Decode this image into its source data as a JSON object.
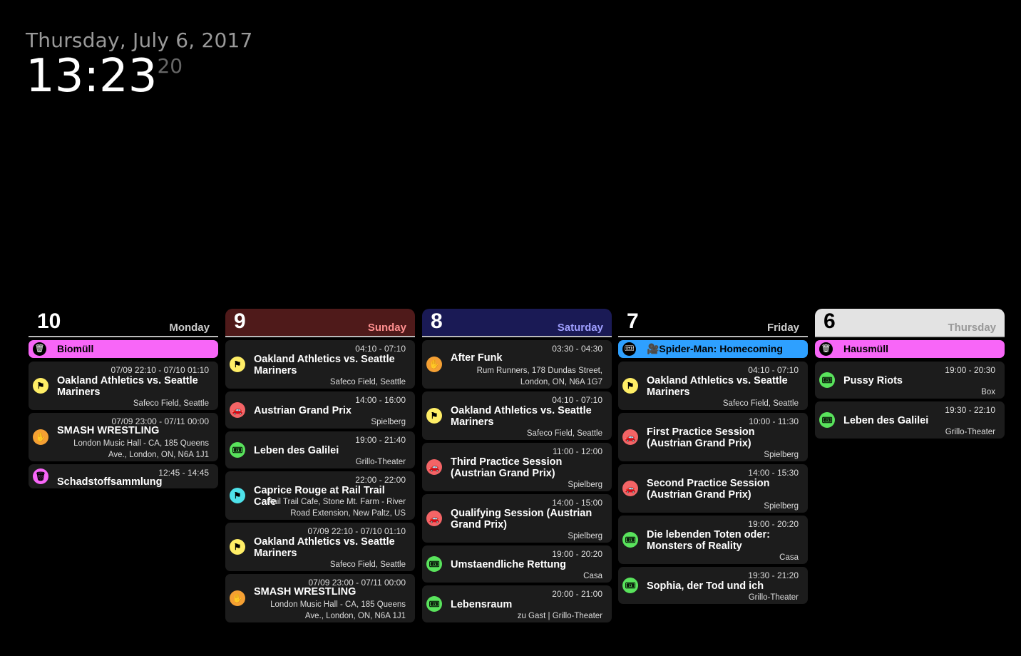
{
  "clock": {
    "date": "Thursday, July 6, 2017",
    "hm": "13:23",
    "sec": "20"
  },
  "colors": {
    "yellow": "#ffee66",
    "orange": "#f5a033",
    "red": "#f46466",
    "green": "#59e35c",
    "cyan": "#4ee2ea",
    "magenta": "#f866f8",
    "blue": "#2ea0ff"
  },
  "days": [
    {
      "num": "10",
      "name": "Monday",
      "allday": [
        {
          "icon": "trash-icon",
          "label": "Biomüll"
        }
      ],
      "events": [
        {
          "icon": "flag-icon",
          "color": "yellow",
          "time": "07/09 22:10 - 07/10 01:10",
          "title": "Oakland Athletics vs. Seattle Mariners",
          "loc": "Safeco Field, Seattle"
        },
        {
          "icon": "hand-icon",
          "color": "orange",
          "time": "07/09 23:00 - 07/11 00:00",
          "title": "SMASH WRESTLING",
          "loc": "London Music Hall - CA, 185 Queens Ave., London, ON, N6A 1J1"
        },
        {
          "icon": "trash-icon",
          "color": "magenta",
          "time": "12:45 - 14:45",
          "title": "Schadstoffsammlung",
          "loc": ""
        }
      ]
    },
    {
      "num": "9",
      "name": "Sunday",
      "allday": [],
      "events": [
        {
          "icon": "flag-icon",
          "color": "yellow",
          "time": "04:10 - 07:10",
          "title": "Oakland Athletics vs. Seattle Mariners",
          "loc": "Safeco Field, Seattle"
        },
        {
          "icon": "car-icon",
          "color": "red",
          "time": "14:00 - 16:00",
          "title": "Austrian Grand Prix",
          "loc": "Spielberg"
        },
        {
          "icon": "ticket-icon",
          "color": "green",
          "time": "19:00 - 21:40",
          "title": "Leben des Galilei",
          "loc": "Grillo-Theater"
        },
        {
          "icon": "flag-icon",
          "color": "cyan",
          "time": "22:00 - 22:00",
          "title": "Caprice Rouge at Rail Trail Cafe",
          "loc": "Rail Trail Cafe, Stone Mt. Farm - River Road Extension, New Paltz, US"
        },
        {
          "icon": "flag-icon",
          "color": "yellow",
          "time": "07/09 22:10 - 07/10 01:10",
          "title": "Oakland Athletics vs. Seattle Mariners",
          "loc": "Safeco Field, Seattle"
        },
        {
          "icon": "hand-icon",
          "color": "orange",
          "time": "07/09 23:00 - 07/11 00:00",
          "title": "SMASH WRESTLING",
          "loc": "London Music Hall - CA, 185 Queens Ave., London, ON, N6A 1J1"
        }
      ]
    },
    {
      "num": "8",
      "name": "Saturday",
      "allday": [],
      "events": [
        {
          "icon": "hand-icon",
          "color": "orange",
          "time": "03:30 - 04:30",
          "title": "After Funk",
          "loc": "Rum Runners, 178 Dundas Street, London, ON, N6A 1G7"
        },
        {
          "icon": "flag-icon",
          "color": "yellow",
          "time": "04:10 - 07:10",
          "title": "Oakland Athletics vs. Seattle Mariners",
          "loc": "Safeco Field, Seattle"
        },
        {
          "icon": "car-icon",
          "color": "red",
          "time": "11:00 - 12:00",
          "title": "Third Practice Session (Austrian Grand Prix)",
          "loc": "Spielberg"
        },
        {
          "icon": "car-icon",
          "color": "red",
          "time": "14:00 - 15:00",
          "title": "Qualifying Session (Austrian Grand Prix)",
          "loc": "Spielberg"
        },
        {
          "icon": "ticket-icon",
          "color": "green",
          "time": "19:00 - 20:20",
          "title": "Umstaendliche Rettung",
          "loc": "Casa"
        },
        {
          "icon": "ticket-icon",
          "color": "green",
          "time": "20:00 - 21:00",
          "title": "Lebensraum",
          "loc": "zu Gast | Grillo-Theater"
        }
      ]
    },
    {
      "num": "7",
      "name": "Friday",
      "allday": [
        {
          "icon": "ticket-icon",
          "label": "🎥Spider-Man: Homecoming"
        }
      ],
      "events": [
        {
          "icon": "flag-icon",
          "color": "yellow",
          "time": "04:10 - 07:10",
          "title": "Oakland Athletics vs. Seattle Mariners",
          "loc": "Safeco Field, Seattle"
        },
        {
          "icon": "car-icon",
          "color": "red",
          "time": "10:00 - 11:30",
          "title": "First Practice Session (Austrian Grand Prix)",
          "loc": "Spielberg"
        },
        {
          "icon": "car-icon",
          "color": "red",
          "time": "14:00 - 15:30",
          "title": "Second Practice Session (Austrian Grand Prix)",
          "loc": "Spielberg"
        },
        {
          "icon": "ticket-icon",
          "color": "green",
          "time": "19:00 - 20:20",
          "title": "Die lebenden Toten oder: Monsters of Reality",
          "loc": "Casa"
        },
        {
          "icon": "ticket-icon",
          "color": "green",
          "time": "19:30 - 21:20",
          "title": "Sophia, der Tod und ich",
          "loc": "Grillo-Theater"
        }
      ]
    },
    {
      "num": "6",
      "name": "Thursday",
      "allday": [
        {
          "icon": "trash-icon",
          "label": "Hausmüll"
        }
      ],
      "events": [
        {
          "icon": "ticket-icon",
          "color": "green",
          "time": "19:00 - 20:30",
          "title": "Pussy Riots",
          "loc": "Box"
        },
        {
          "icon": "ticket-icon",
          "color": "green",
          "time": "19:30 - 22:10",
          "title": "Leben des Galilei",
          "loc": "Grillo-Theater"
        }
      ]
    }
  ]
}
